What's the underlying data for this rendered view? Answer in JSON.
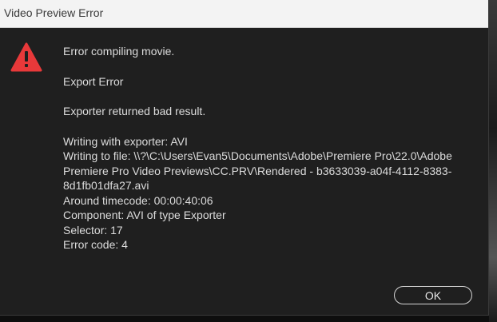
{
  "window": {
    "title": "Video Preview Error"
  },
  "icon": {
    "name": "warning-icon",
    "color": "#e8393a"
  },
  "message": {
    "line1": "Error compiling movie.",
    "line2": "Export Error",
    "line3": "Exporter returned bad result.",
    "details": [
      "Writing with exporter: AVI",
      "Writing to file: \\\\?\\C:\\Users\\Evan5\\Documents\\Adobe\\Premiere Pro\\22.0\\Adobe",
      "Premiere Pro Video Previews\\CC.PRV\\Rendered - b3633039-a04f-4112-8383-",
      "8d1fb01dfa27.avi",
      "Around timecode: 00:00:40:06",
      "Component: AVI of type Exporter",
      "Selector: 17",
      "Error code: 4"
    ]
  },
  "buttons": {
    "ok_label": "OK"
  }
}
